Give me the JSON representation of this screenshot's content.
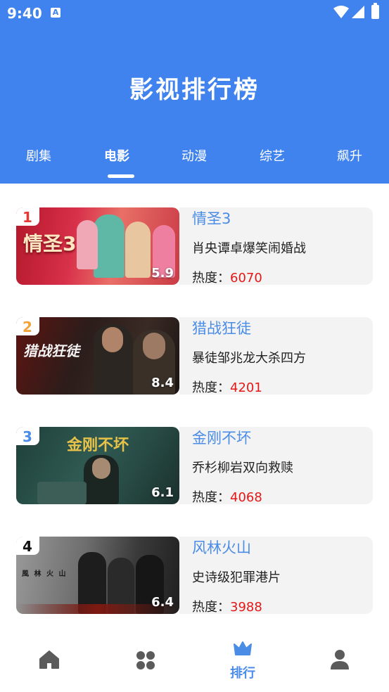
{
  "status_bar": {
    "time": "9:40",
    "notification_icon": "A"
  },
  "header": {
    "title": "影视排行榜"
  },
  "tabs": [
    {
      "label": "剧集"
    },
    {
      "label": "电影",
      "active": true
    },
    {
      "label": "动漫"
    },
    {
      "label": "综艺"
    },
    {
      "label": "飙升"
    }
  ],
  "movies": [
    {
      "rank": "1",
      "rank_color": "#e53935",
      "title": "情圣3",
      "desc": "肖央谭卓爆笑闹婚战",
      "heat_label": "热度：",
      "heat_value": "6070",
      "score": "5.9",
      "poster_text": "情圣3"
    },
    {
      "rank": "2",
      "rank_color": "#f2a33c",
      "title": "猎战狂徒",
      "desc": "暴徒邹兆龙大杀四方",
      "heat_label": "热度：",
      "heat_value": "4201",
      "score": "8.4",
      "poster_text": "猎战狂徒"
    },
    {
      "rank": "3",
      "rank_color": "#4a8ce6",
      "title": "金刚不坏",
      "desc": "乔杉柳岩双向救赎",
      "heat_label": "热度：",
      "heat_value": "4068",
      "score": "6.1",
      "poster_text": "金刚不坏"
    },
    {
      "rank": "4",
      "rank_color": "#111111",
      "title": "风林火山",
      "desc": "史诗级犯罪港片",
      "heat_label": "热度：",
      "heat_value": "3988",
      "score": "6.4",
      "poster_text": "風 林 火 山"
    }
  ],
  "bottom_nav": [
    {
      "icon": "home-icon"
    },
    {
      "icon": "grid-icon"
    },
    {
      "icon": "crown-icon",
      "label": "排行",
      "active": true
    },
    {
      "icon": "user-icon"
    }
  ],
  "colors": {
    "brand": "#4083ef",
    "accent_text": "#4a8ce6",
    "heat": "#e41818"
  }
}
